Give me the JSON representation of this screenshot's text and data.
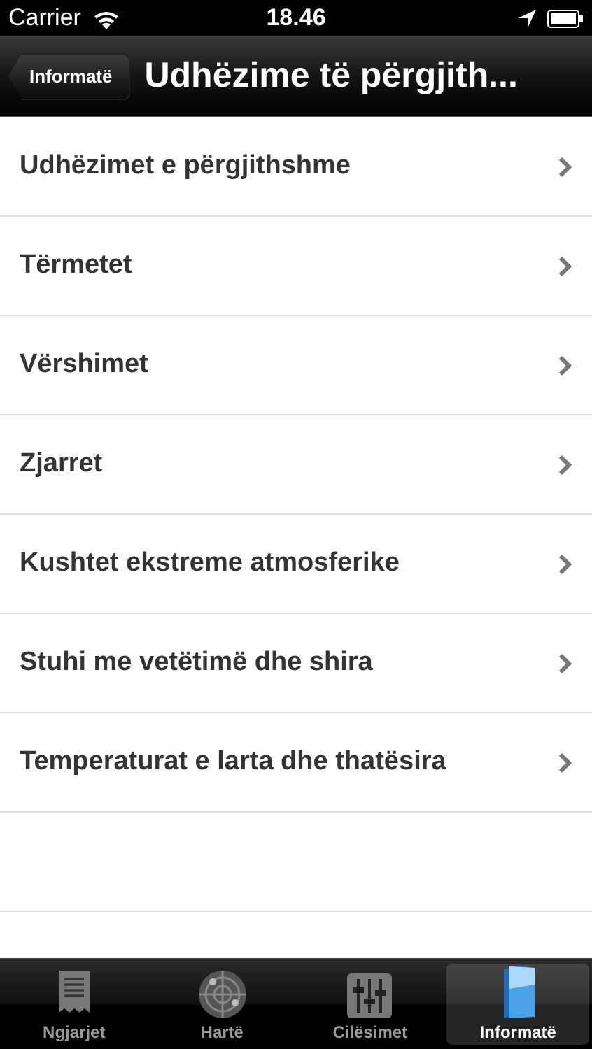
{
  "status_bar": {
    "carrier": "Carrier",
    "time": "18.46"
  },
  "nav_bar": {
    "back_button": "Informatë",
    "title": "Udhëzime të përgjith..."
  },
  "list": [
    {
      "label": "Udhëzimet e përgjithshme"
    },
    {
      "label": "Tërmetet"
    },
    {
      "label": "Vërshimet"
    },
    {
      "label": "Zjarret"
    },
    {
      "label": "Kushtet ekstreme atmosferike"
    },
    {
      "label": "Stuhi me vetëtimë dhe shira"
    },
    {
      "label": "Temperaturat e larta dhe thatësira"
    }
  ],
  "tab_bar": [
    {
      "kind": "events",
      "label": "Ngjarjet",
      "selected": false
    },
    {
      "kind": "map",
      "label": "Hartë",
      "selected": false
    },
    {
      "kind": "settings",
      "label": "Cilësimet",
      "selected": false
    },
    {
      "kind": "info",
      "label": "Informatë",
      "selected": true
    }
  ]
}
